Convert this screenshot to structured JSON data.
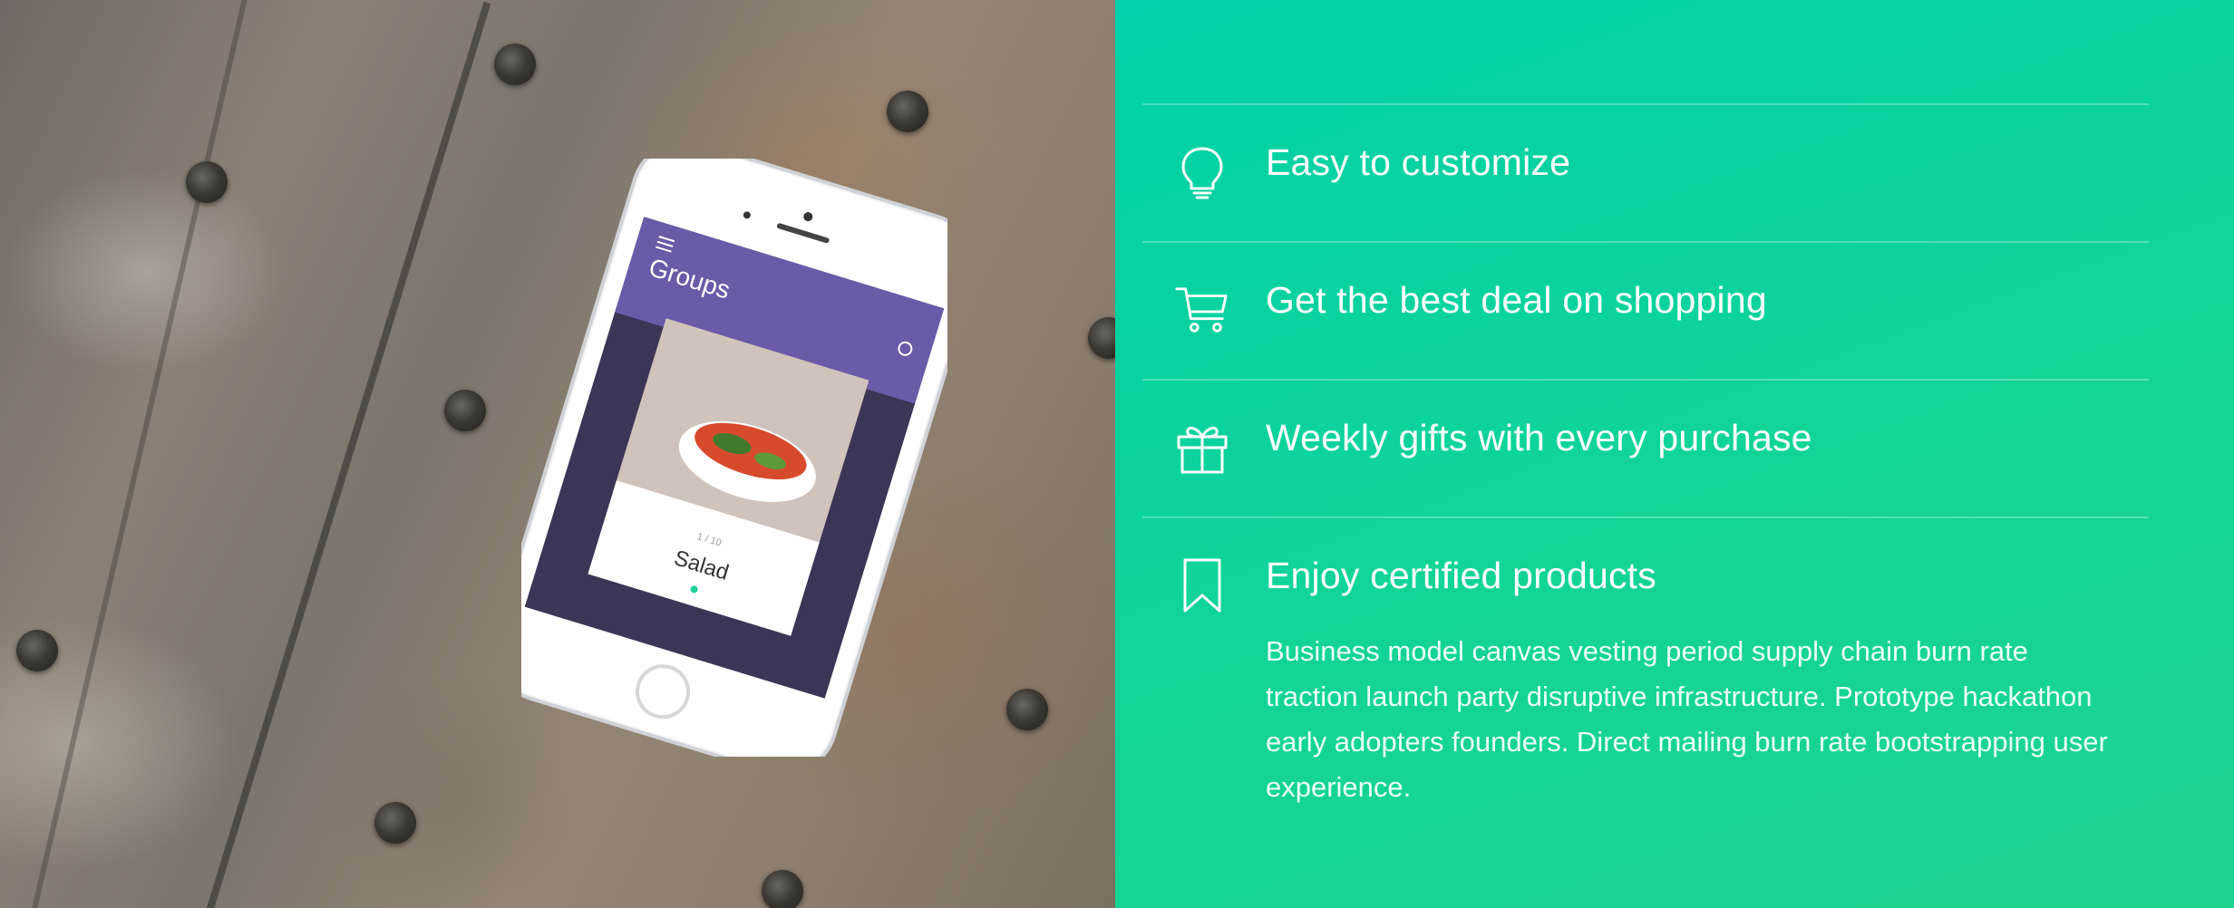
{
  "photo": {
    "phone_app": {
      "header_title": "Groups",
      "card_caption": "Salad",
      "card_small": "1 / 10"
    }
  },
  "features": {
    "items": [
      {
        "icon": "lightbulb-icon",
        "title": "Easy to customize"
      },
      {
        "icon": "shopping-cart-icon",
        "title": "Get the best deal on shopping"
      },
      {
        "icon": "gift-icon",
        "title": "Weekly gifts with every purchase"
      },
      {
        "icon": "bookmark-icon",
        "title": "Enjoy certified products"
      }
    ],
    "description": "Business model canvas vesting period supply chain burn rate traction launch party disruptive infrastructure. Prototype hackathon early adopters founders. Direct mailing burn rate bootstrapping user experience."
  },
  "colors": {
    "accent": "#00d1a8",
    "accent_end": "#1ed38d",
    "text": "#ffffff"
  }
}
